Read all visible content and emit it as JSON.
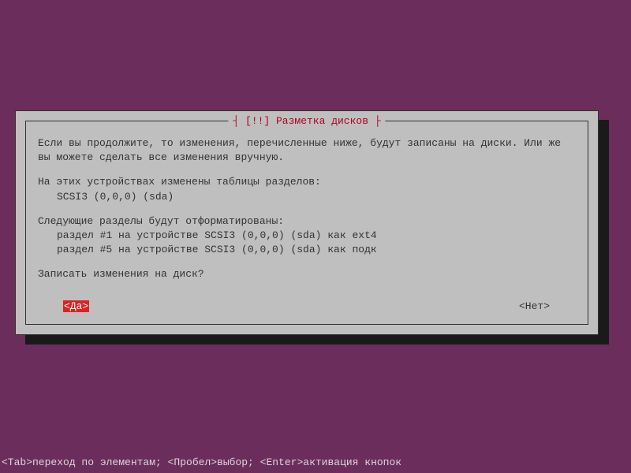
{
  "dialog": {
    "title": "[!!] Разметка дисков",
    "paragraph1": "Если вы продолжите, то изменения, перечисленные ниже, будут записаны на диски. Или же вы можете сделать все изменения вручную.",
    "partition_tables_header": "На этих устройствах изменены таблицы разделов:",
    "partition_tables_items": [
      "SCSI3 (0,0,0) (sda)"
    ],
    "format_header": "Следующие разделы будут отформатированы:",
    "format_items": [
      "раздел #1 на устройстве SCSI3 (0,0,0) (sda) как ext4",
      "раздел #5 на устройстве SCSI3 (0,0,0) (sda) как подк"
    ],
    "confirm_question": "Записать изменения на диск?",
    "buttons": {
      "yes": "<Да>",
      "no": "<Нет>"
    }
  },
  "footer": "<Tab>переход по элементам; <Пробел>выбор; <Enter>активация кнопок"
}
